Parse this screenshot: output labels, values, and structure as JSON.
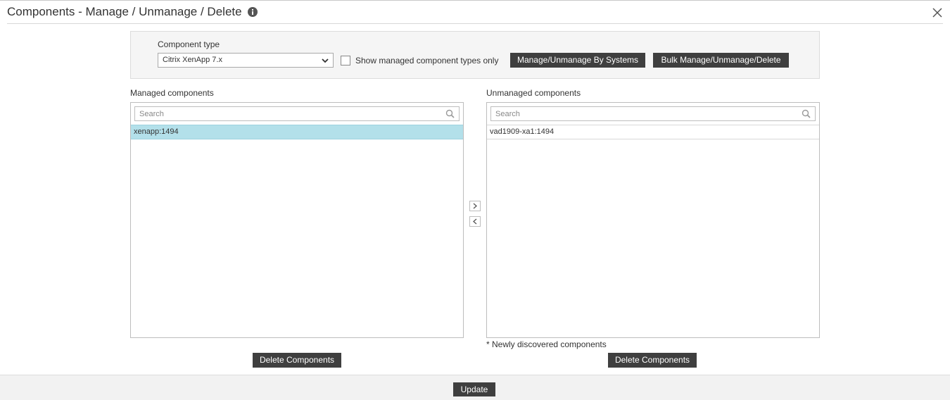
{
  "header": {
    "title": "Components - Manage / Unmanage / Delete",
    "info_icon": "info-circle-icon",
    "close_icon": "close-x-icon"
  },
  "component_type": {
    "label": "Component type",
    "selected": "Citrix XenApp 7.x",
    "show_managed_label": "Show managed component types only",
    "show_managed_checked": false,
    "manage_by_systems_button": "Manage/Unmanage By Systems",
    "bulk_button": "Bulk Manage/Unmanage/Delete"
  },
  "managed": {
    "label": "Managed components",
    "search_placeholder": "Search",
    "items": [
      {
        "name": "xenapp:1494",
        "selected": true
      }
    ],
    "delete_button": "Delete Components"
  },
  "unmanaged": {
    "label": "Unmanaged components",
    "search_placeholder": "Search",
    "items": [
      {
        "name": "vad1909-xa1:1494",
        "selected": false
      }
    ],
    "note": "* Newly discovered components",
    "delete_button": "Delete Components"
  },
  "transfer": {
    "move_right_icon": "chevron-right-icon",
    "move_left_icon": "chevron-left-icon"
  },
  "footer": {
    "update_button": "Update"
  },
  "colors": {
    "dark_button": "#3f3f3f",
    "selected_row": "#b3e0ea",
    "panel_bg": "#f5f5f5"
  }
}
